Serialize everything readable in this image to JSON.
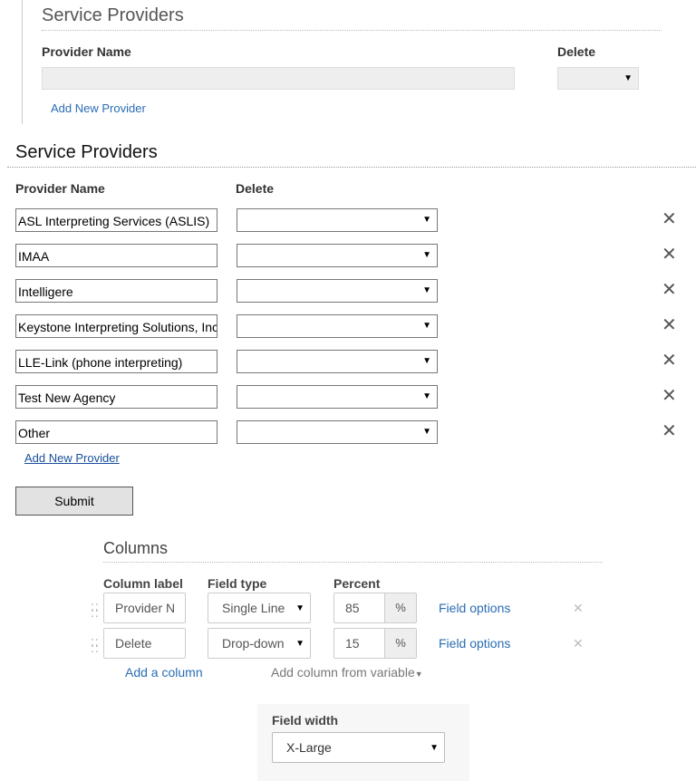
{
  "section1": {
    "title": "Service Providers",
    "col_provider": "Provider Name",
    "col_delete": "Delete",
    "add_link": "Add New Provider"
  },
  "section2": {
    "title": "Service Providers",
    "col_provider": "Provider Name",
    "col_delete": "Delete",
    "providers": [
      {
        "name": "ASL Interpreting Services (ASLIS)",
        "delete": ""
      },
      {
        "name": "IMAA",
        "delete": ""
      },
      {
        "name": "Intelligere",
        "delete": ""
      },
      {
        "name": "Keystone Interpreting Solutions, Inc",
        "delete": ""
      },
      {
        "name": "LLE-Link (phone interpreting)",
        "delete": ""
      },
      {
        "name": "Test New Agency",
        "delete": ""
      },
      {
        "name": "Other",
        "delete": ""
      }
    ],
    "add_link": "Add New Provider",
    "submit_label": "Submit"
  },
  "columns": {
    "title": "Columns",
    "hdr_label": "Column label",
    "hdr_type": "Field type",
    "hdr_percent": "Percent",
    "rows": [
      {
        "label": "Provider N",
        "type": "Single Line",
        "percent": "85",
        "pct_symbol": "%",
        "options": "Field options"
      },
      {
        "label": "Delete",
        "type": "Drop-down",
        "percent": "15",
        "pct_symbol": "%",
        "options": "Field options"
      }
    ],
    "add_column": "Add a column",
    "add_from_variable": "Add column from variable"
  },
  "field_width": {
    "label": "Field width",
    "value": "X-Large"
  },
  "icons": {
    "delete": "close-icon",
    "select_arrow": "caret-down-icon",
    "drag": "drag-handle-icon"
  }
}
